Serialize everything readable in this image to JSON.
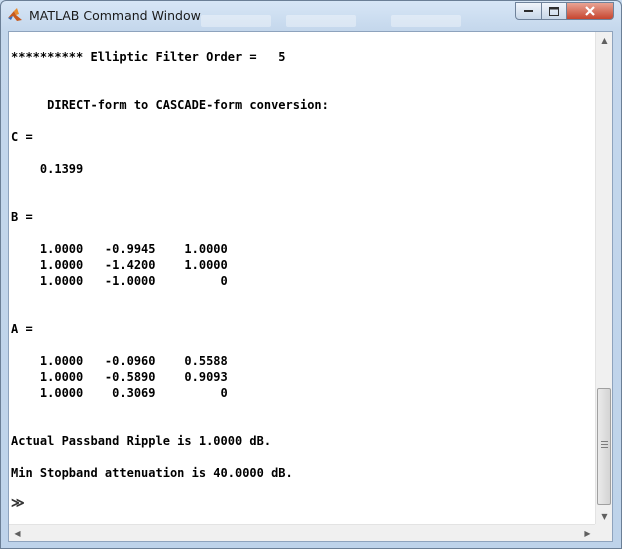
{
  "window": {
    "title": "MATLAB Command Window",
    "minimize_icon": "minimize-icon",
    "maximize_icon": "maximize-icon",
    "close_icon": "close-icon"
  },
  "console": {
    "lines": [
      "********** Elliptic Filter Order =   5",
      "     DIRECT-form to CASCADE-form conversion:",
      "C =",
      "    0.1399",
      "B =",
      "    1.0000   -0.9945    1.0000",
      "    1.0000   -1.4200    1.0000",
      "    1.0000   -1.0000         0",
      "A =",
      "    1.0000   -0.0960    0.5588",
      "    1.0000   -0.5890    0.9093",
      "    1.0000    0.3069         0",
      "Actual Passband Ripple is 1.0000 dB.",
      "Min Stopband attenuation is 40.0000 dB."
    ],
    "prompt": "≫"
  },
  "scrollbars": {
    "vertical_position": 0.95,
    "horizontal_position": 0.0
  }
}
